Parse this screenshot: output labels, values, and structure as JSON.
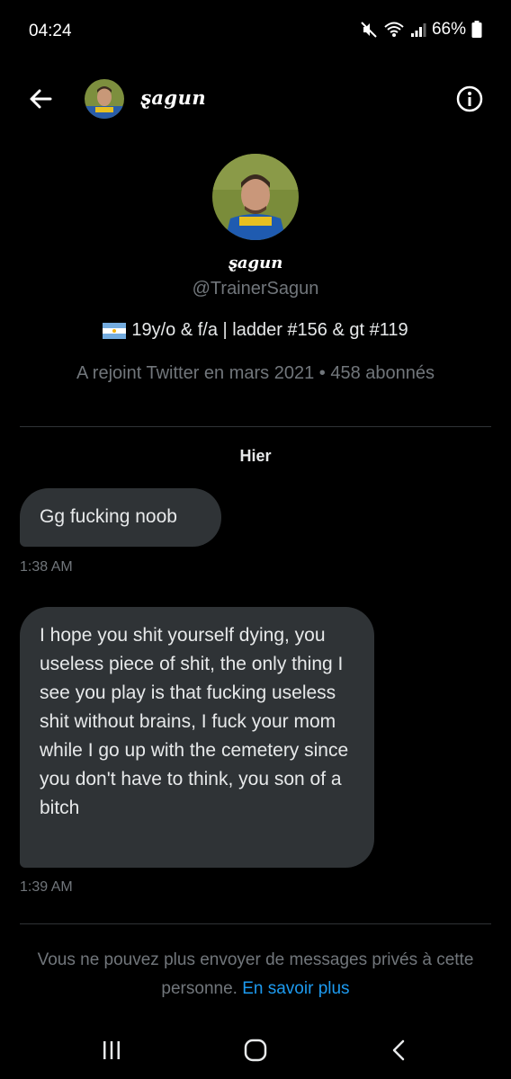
{
  "status_bar": {
    "time": "04:24",
    "battery": "66%",
    "icons": [
      "mute-icon",
      "wifi-icon",
      "signal-icon",
      "battery-icon"
    ]
  },
  "header": {
    "name": "ȿagun",
    "icons": [
      "back-arrow-icon",
      "info-icon"
    ]
  },
  "profile": {
    "name": "ȿagun",
    "handle": "@TrainerSagun",
    "bio_text": "19y/o & f/a | ladder #156 & gt #119",
    "bio_flag": "argentina-flag-icon",
    "meta": "A rejoint Twitter en mars 2021 • 458 abonnés"
  },
  "conversation": {
    "day_label": "Hier",
    "messages": [
      {
        "text": "Gg fucking noob",
        "time": "1:38 AM"
      },
      {
        "text": "I hope you shit yourself dying, you useless piece of shit, the only thing I see you play is that fucking useless shit without brains, I fuck your mom while I go up with the cemetery since you don't have to think, you son of a bitch",
        "time": "1:39 AM"
      }
    ]
  },
  "notice": {
    "text": "Vous ne pouvez plus envoyer de messages privés à cette personne.",
    "link": "En savoir plus"
  },
  "navbar": {
    "icons": [
      "recent-apps-icon",
      "home-icon",
      "back-icon"
    ]
  },
  "colors": {
    "background": "#000000",
    "bubble": "#2f3336",
    "muted": "#71767b",
    "link": "#1d9bf0",
    "text": "#e7e9ea"
  }
}
